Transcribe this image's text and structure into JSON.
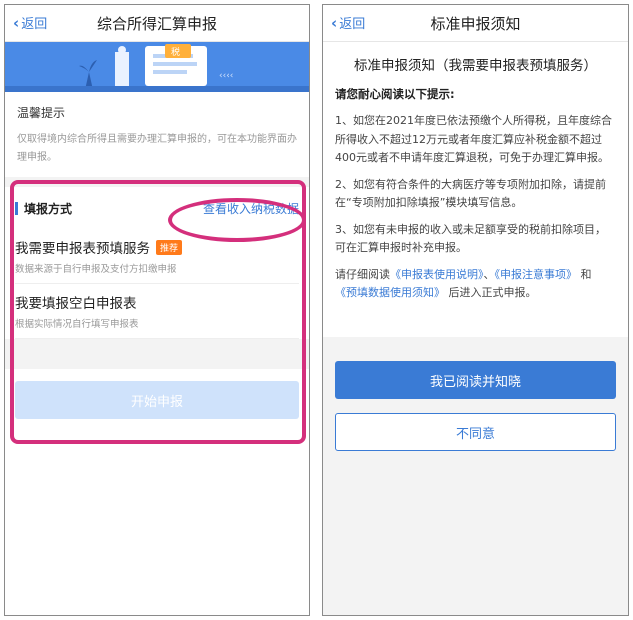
{
  "left": {
    "nav": {
      "back": "返回",
      "title": "综合所得汇算申报"
    },
    "tips": {
      "heading": "温馨提示",
      "text": "仅取得境内综合所得且需要办理汇算申报的，可在本功能界面办理申报。"
    },
    "method": {
      "label": "填报方式",
      "link": "查看收入纳税数据",
      "options": [
        {
          "title": "我需要申报表预填服务",
          "badge": "推荐",
          "sub": "数据来源于自行申报及支付方扣缴申报"
        },
        {
          "title": "我要填报空白申报表",
          "badge": "",
          "sub": "根据实际情况自行填写申报表"
        }
      ]
    },
    "start_button": "开始申报"
  },
  "right": {
    "nav": {
      "back": "返回",
      "title": "标准申报须知"
    },
    "title": "标准申报须知（我需要申报表预填服务）",
    "subtitle": "请您耐心阅读以下提示:",
    "paragraphs": [
      "1、如您在2021年度已依法预缴个人所得税，且年度综合所得收入不超过12万元或者年度汇算应补税金额不超过400元或者不申请年度汇算退税，可免于办理汇算申报。",
      "2、如您有符合条件的大病医疗等专项附加扣除，请提前在“专项附加扣除填报”模块填写信息。",
      "3、如您有未申报的收入或未足额享受的税前扣除项目，可在汇算申报时补充申报。"
    ],
    "read_prefix": "请仔细阅读",
    "read_link1": "《申报表使用说明》",
    "read_sep1": "、",
    "read_link2": "《申报注意事项》",
    "read_and": "和",
    "read_link3": "《预填数据使用须知》",
    "read_suffix": "后进入正式申报。",
    "agree_button": "我已阅读并知晓",
    "disagree_button": "不同意"
  },
  "colors": {
    "accent": "#3a7bd5",
    "highlight": "#d42f7c",
    "badge": "#ff7a1a"
  }
}
